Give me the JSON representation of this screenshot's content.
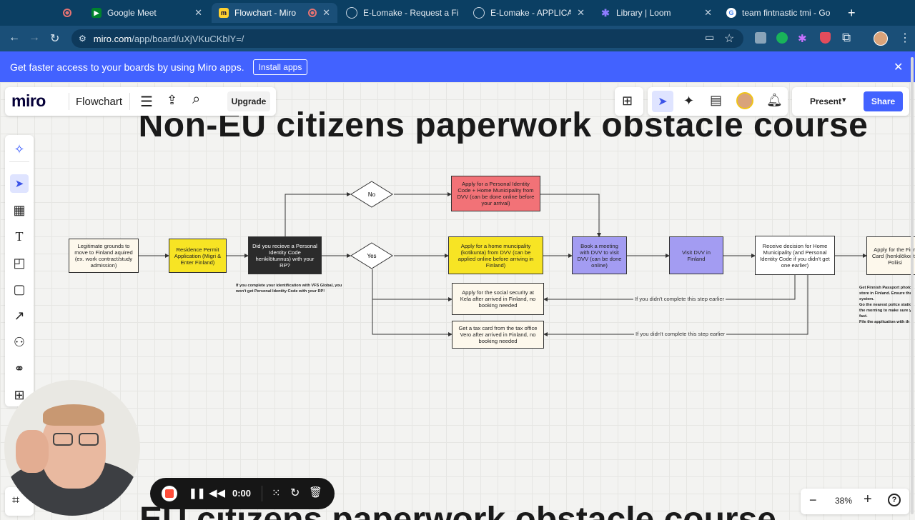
{
  "tabs": [
    {
      "title": "",
      "kind": "record"
    },
    {
      "title": "Google Meet",
      "kind": "meet"
    },
    {
      "title": "Flowchart - Miro",
      "kind": "miro",
      "active": true
    },
    {
      "title": "E-Lomake - Request a Fi",
      "kind": "globe"
    },
    {
      "title": "E-Lomake - APPLICATIO",
      "kind": "globe"
    },
    {
      "title": "Library | Loom",
      "kind": "loom"
    },
    {
      "title": "team fintnastic tmi - Go",
      "kind": "google"
    }
  ],
  "new_tab": "+",
  "address": {
    "domain": "miro.com",
    "path": "/app/board/uXjVKuCKblY=/"
  },
  "banner": {
    "text": "Get faster access to your boards by using Miro apps.",
    "button": "Install apps",
    "close": "✕"
  },
  "miro": {
    "logo": "miro",
    "board_name": "Flowchart",
    "upgrade": "Upgrade",
    "present": "Present",
    "share": "Share",
    "zoom": "38%",
    "zoom_minus": "−",
    "zoom_plus": "+",
    "help": "?"
  },
  "board": {
    "title": "Non-EU citizens paperwork obstacle course",
    "bottom_title": "EU citizens paperwork obstacle course",
    "nodes": {
      "grounds": "Legitimate grounds to move to Finland aquired (ex. work contract/study admission)",
      "rp_app": "Residence Permit Application (Migri & Enter Finland)",
      "received": "Did you recieve a Personal Identity Code henkilötunnus) with your RP?",
      "no": "No",
      "yes": "Yes",
      "pic_dvv": "Apply for a Personal Identity Code + Home Municipality from DVV (can be done online before your arrival)",
      "home_muni": "Apply for a home muncipality (kotikunta) from DVV (can be applied online before arriving in Finland)",
      "book": "Book a meeting with DVV to visit DVV (can be done online)",
      "visit": "Visit DVV in Finland",
      "decision": "Receive decision for Home Municipality (and Personal Identity Code if you didn't get one earlier)",
      "apply_id": "Apply for the Finn Card (henkilökortti) Poliisi",
      "kela": "Apply for the social security at Kela after arrived in Finland, no booking needed",
      "tax": "Get a tax card from the tax office Vero after arrived in Finland, no booking needed"
    },
    "vfs_note": "If you complete your identification with VFS Global, you won't get Personal Identity Code with your RP!",
    "skip1": "If you didn't complete this step earlier",
    "skip2": "If you didn't complete this step earlier",
    "side_note": [
      "Get Finnish Passport photo",
      "store in Finland. Ensure the",
      "system.",
      "Go the nearest police statio",
      "the morning to make sure y",
      "fast.",
      "File the application with th"
    ]
  },
  "recorder": {
    "time": "0:00"
  },
  "colors": {
    "tabstrip": "#0b3f63",
    "banner": "#4262ff",
    "share": "#4262ff",
    "yellow": "#f7e424",
    "red": "#f27277",
    "purple": "#a39cf2"
  }
}
